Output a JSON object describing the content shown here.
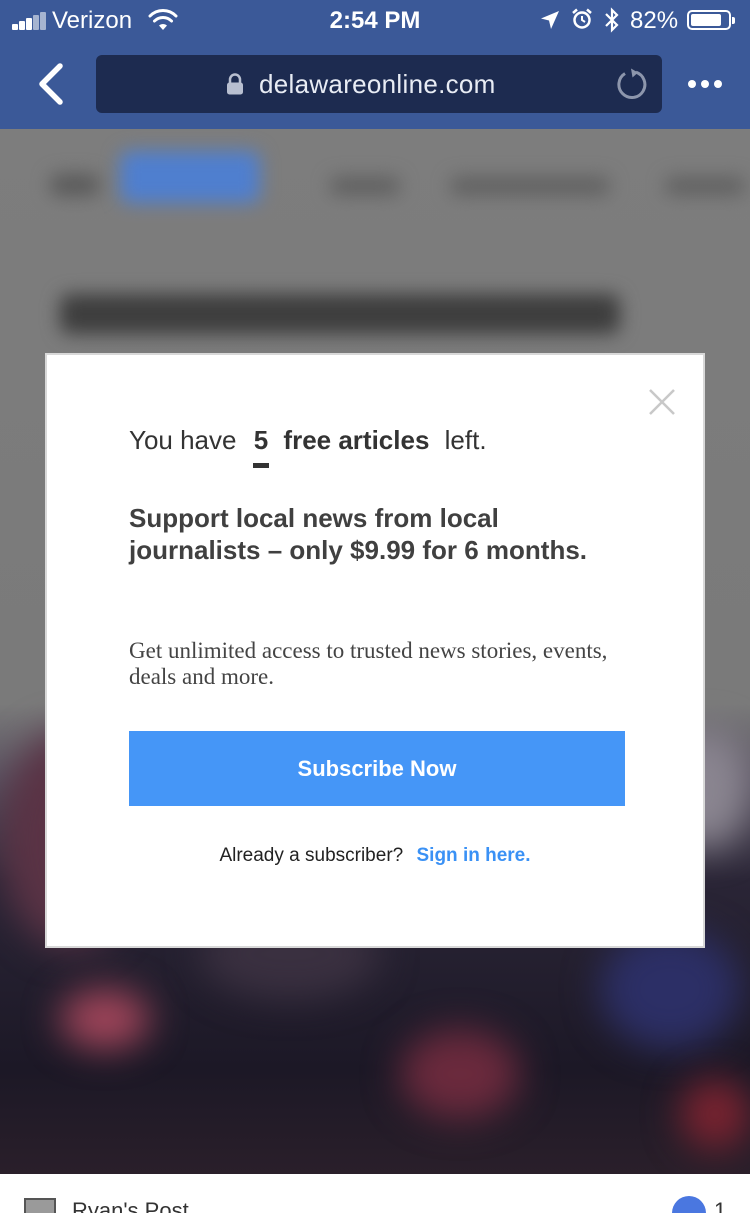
{
  "status_bar": {
    "carrier": "Verizon",
    "time": "2:54 PM",
    "battery": "82%",
    "battery_level": 0.82,
    "icons": [
      "signal-icon",
      "wifi-icon",
      "location-icon",
      "alarm-icon",
      "bluetooth-icon",
      "battery-icon"
    ]
  },
  "browser": {
    "url": "delawareonline.com",
    "icons": [
      "back-icon",
      "lock-icon",
      "reload-icon",
      "more-icon"
    ]
  },
  "modal": {
    "headline_prefix": "You have",
    "count": "5",
    "headline_bold": "free articles",
    "headline_suffix": "left.",
    "pitch": "Support local news from local journalists – only $9.99 for 6 months.",
    "blurb": "Get unlimited access to trusted news stories, events, deals and more.",
    "subscribe_label": "Subscribe Now",
    "already_text": "Already a subscriber?",
    "signin_label": "Sign in here.",
    "accent": "#4596f7"
  },
  "bottom": {
    "post_title": "Ryan's Post",
    "like_count": "1"
  },
  "colors": {
    "header": "#3b5998",
    "url_bar": "#1d2b50",
    "button": "#4596f7",
    "link": "#3a91f5"
  }
}
